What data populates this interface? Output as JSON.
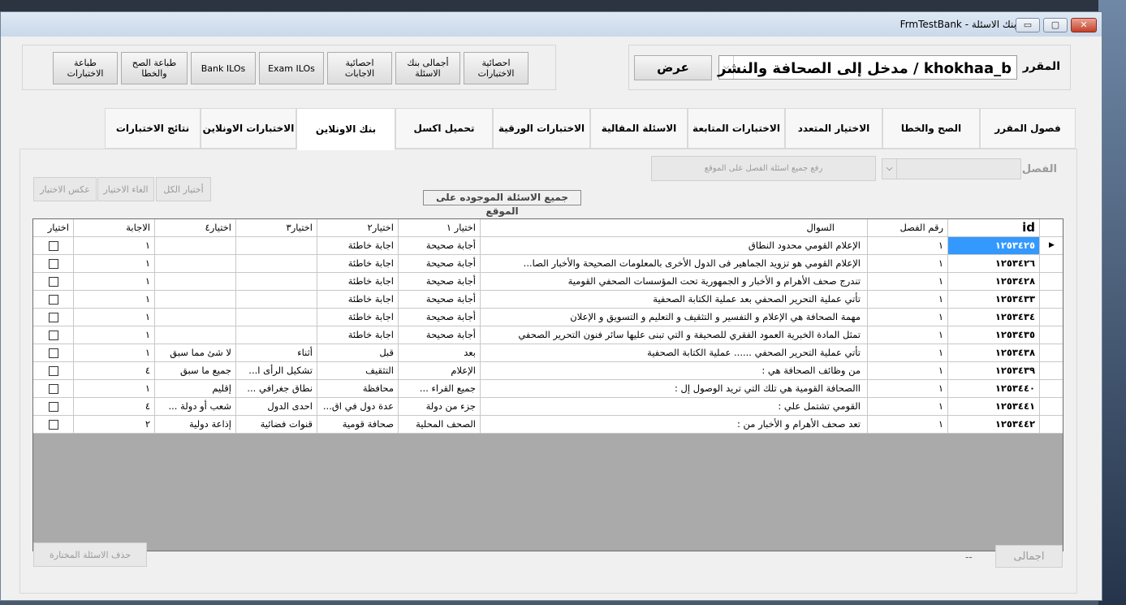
{
  "window": {
    "title": "بنك الاسئلة - FrmTestBank",
    "min": "▭",
    "max": "▢",
    "close": "✕"
  },
  "toolbar": {
    "buttons": [
      "طباعة الاختبارات",
      "طباعة الصح والخطا",
      "Bank ILOs",
      "Exam ILOs",
      "احصائية الاجابات",
      "أجمالى بنك الاسئلة",
      "احصائية الاختبارات"
    ]
  },
  "course": {
    "label": "المقرر",
    "value": "مدخل إلى الصحافة والنشر الرقمي / khokhaa_b",
    "show_button": "عرض"
  },
  "tabs": [
    "فصول المقرر",
    "الصح والخطا",
    "الاختيار المتعدد",
    "الاختبارات المتابعة",
    "الاسئلة المقالية",
    "الاختبارات الورقية",
    "تحميل اكسل",
    "بنك الاونلاين",
    "الاختبارات الاونلاين",
    "نتائج الاختبارات"
  ],
  "active_tab": "بنك الاونلاين",
  "chapter": {
    "label": "الفصل",
    "upload_button": "رفع جميع اسئلة الفصل على الموقع"
  },
  "selection_buttons": {
    "select_all": "أختيار الكل",
    "cancel": "الغاء الاختيار",
    "invert": "عكس الاختيار"
  },
  "caption": "جميع الاسئلة الموجوده على الموقع",
  "table": {
    "headers": {
      "id": "id",
      "chapter": "رقم الفصل",
      "question": "السوال",
      "c1": "اختيار ١",
      "c2": "اختيار٢",
      "c3": "اختيار٣",
      "c4": "اختيار٤",
      "answer": "الاجابة",
      "select": "اختيار"
    },
    "rows": [
      {
        "id": "١٢٥٣٤٢٥",
        "ch": "١",
        "q": "الإعلام القومي محدود النطاق",
        "c1": "أجابة صحيحة",
        "c2": "اجابة خاطئة",
        "c3": "",
        "c4": "",
        "a": "١"
      },
      {
        "id": "١٢٥٣٤٢٦",
        "ch": "١",
        "q": "الإعلام القومي هو تزويد الجماهير فى الدول الأخرى بالمعلومات الصحيحة والأخبار الصا...",
        "c1": "أجابة صحيحة",
        "c2": "اجابة خاطئة",
        "c3": "",
        "c4": "",
        "a": "١"
      },
      {
        "id": "١٢٥٣٤٢٨",
        "ch": "١",
        "q": "تندرج صحف الأهرام و الأخبار و الجمهورية تحت المؤسسات الصحفي القومية",
        "c1": "أجابة صحيحة",
        "c2": "اجابة خاطئة",
        "c3": "",
        "c4": "",
        "a": "١"
      },
      {
        "id": "١٢٥٣٤٣٣",
        "ch": "١",
        "q": "تأتي عملية التحرير الصحفي بعد عملية الكتابة الصحفية",
        "c1": "أجابة صحيحة",
        "c2": "اجابة خاطئة",
        "c3": "",
        "c4": "",
        "a": "١"
      },
      {
        "id": "١٢٥٣٤٣٤",
        "ch": "١",
        "q": "مهمة الصحافة هي الإعلام و التفسير و التثقيف و التعليم و التسويق و الإعلان",
        "c1": "أجابة صحيحة",
        "c2": "اجابة خاطئة",
        "c3": "",
        "c4": "",
        "a": "١"
      },
      {
        "id": "١٢٥٣٤٣٥",
        "ch": "١",
        "q": "تمثل المادة الخبرية العمود الفقري للصحيفة و التي تبنى عليها سائر فنون التحرير الصحفي",
        "c1": "أجابة صحيحة",
        "c2": "اجابة خاطئة",
        "c3": "",
        "c4": "",
        "a": "١"
      },
      {
        "id": "١٢٥٣٤٣٨",
        "ch": "١",
        "q": "تأتي عملية التحرير الصحفي ...... عملية الكتابة الصحفية",
        "c1": "بعد",
        "c2": "قبل",
        "c3": "أثناء",
        "c4": "لا شئ مما سبق",
        "a": "١"
      },
      {
        "id": "١٢٥٣٤٣٩",
        "ch": "١",
        "q": "من وظائف الصحافة هي :",
        "c1": "الإعلام",
        "c2": "التثقيف",
        "c3": "تشكيل الرأى ا...",
        "c4": "جميع ما سبق",
        "a": "٤"
      },
      {
        "id": "١٢٥٣٤٤٠",
        "ch": "١",
        "q": "االصحافة القومية هي تلك التي تريد الوصول إل :",
        "c1": "جميع القراء ...",
        "c2": "محافظة",
        "c3": "نطاق جغرافي ...",
        "c4": "إقليم",
        "a": "١"
      },
      {
        "id": "١٢٥٣٤٤١",
        "ch": "١",
        "q": "القومي تشتمل علي :",
        "c1": "جزء من دولة",
        "c2": "عدة دول في اق...",
        "c3": "احدى الدول",
        "c4": "شعب أو دولة ...",
        "a": "٤"
      },
      {
        "id": "١٢٥٣٤٤٢",
        "ch": "١",
        "q": "تعد صحف الأهرام و الأخبار من :",
        "c1": "الصحف المحلية",
        "c2": "صحافة قومية",
        "c3": "قنوات فضائية",
        "c4": "إذاعة دولية",
        "a": "٢"
      }
    ],
    "current_row_marker": "▶"
  },
  "footer": {
    "delete_button": "حذف الاسئلة المختارة",
    "total_button": "اجمالى",
    "total_value": "--"
  }
}
